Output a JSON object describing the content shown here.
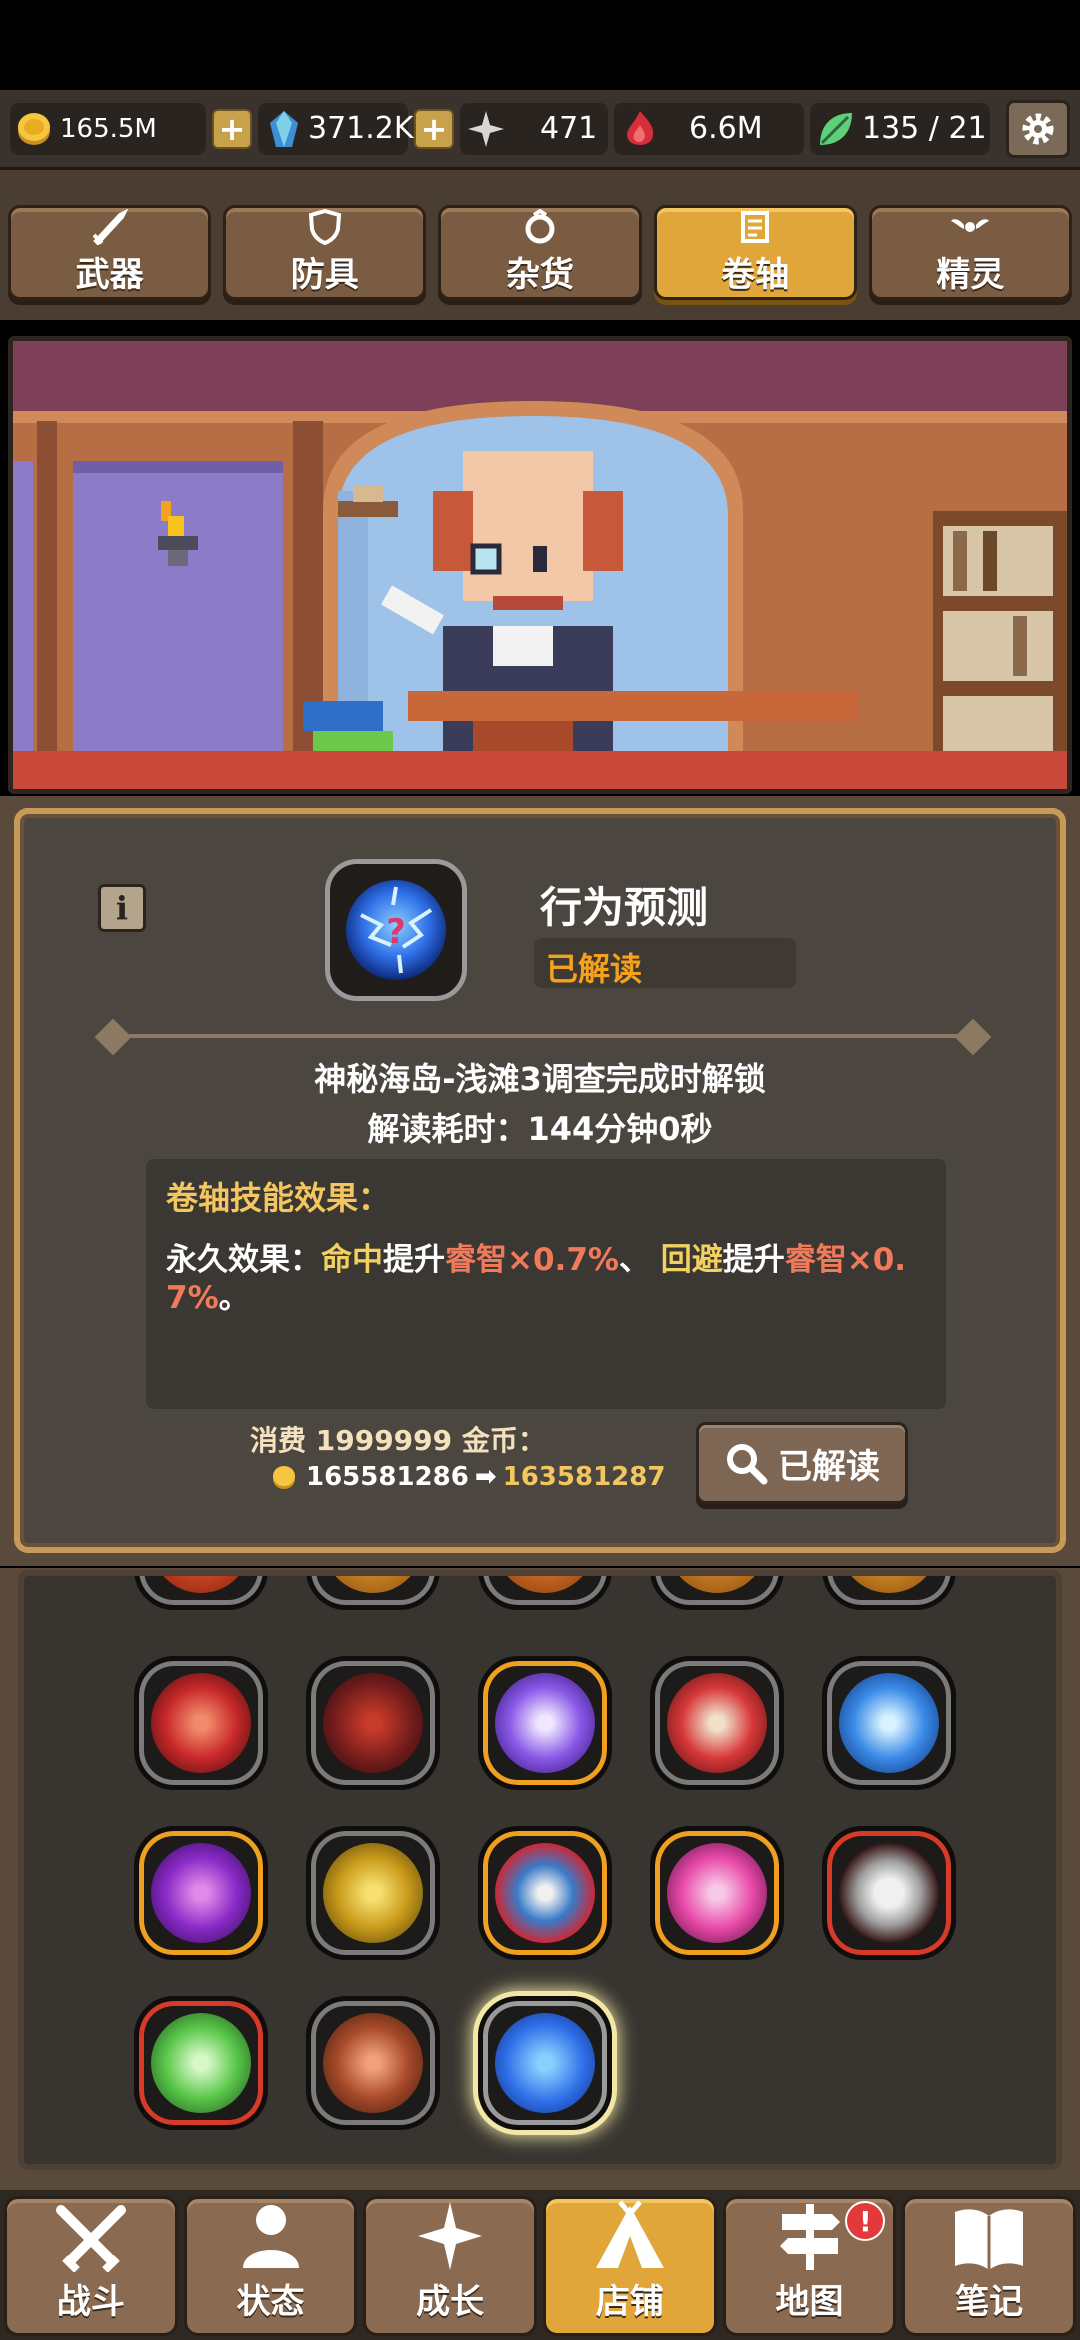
{
  "resources": {
    "gold": "165.5M",
    "crystal": "371.2K",
    "star": "471",
    "flame": "6.6M",
    "leaf": "135 / 21"
  },
  "tabs": [
    {
      "label": "武器",
      "icon": "sword-icon"
    },
    {
      "label": "防具",
      "icon": "shield-icon"
    },
    {
      "label": "杂货",
      "icon": "ring-icon"
    },
    {
      "label": "卷轴",
      "icon": "scroll-icon",
      "active": true
    },
    {
      "label": "精灵",
      "icon": "wings-icon"
    }
  ],
  "detail": {
    "info_label": "i",
    "title": "行为预测",
    "status": "已解读",
    "unlock_condition": "神秘海岛-浅滩3调查完成时解锁",
    "read_time": "解读耗时：144分钟0秒",
    "effect_title": "卷轴技能效果：",
    "effect": {
      "prefix": "永久效果：",
      "stat1": "命中",
      "mid1": "提升",
      "attr1": "睿智×0.7%",
      "sep": "、 ",
      "stat2": "回避",
      "mid2": "提升",
      "attr2": "睿智×0.7%",
      "suffix": "。"
    },
    "cost_label": "消费 1999999 金币：",
    "cost_before": "165581286",
    "cost_arrow": "➡",
    "cost_after": "163581287",
    "read_button": "已解读"
  },
  "nav": [
    {
      "label": "战斗",
      "icon": "crossed-swords-icon"
    },
    {
      "label": "状态",
      "icon": "person-icon"
    },
    {
      "label": "成长",
      "icon": "sparkle-icon"
    },
    {
      "label": "店铺",
      "icon": "tent-icon",
      "active": true
    },
    {
      "label": "地图",
      "icon": "signpost-icon",
      "badge": "!"
    },
    {
      "label": "笔记",
      "icon": "book-icon"
    }
  ],
  "colors": {
    "accent_gold": "#e0a63a",
    "status_orange": "#f4a11e",
    "highlight_yellow": "#f3d160",
    "highlight_red": "#f07a5a"
  }
}
